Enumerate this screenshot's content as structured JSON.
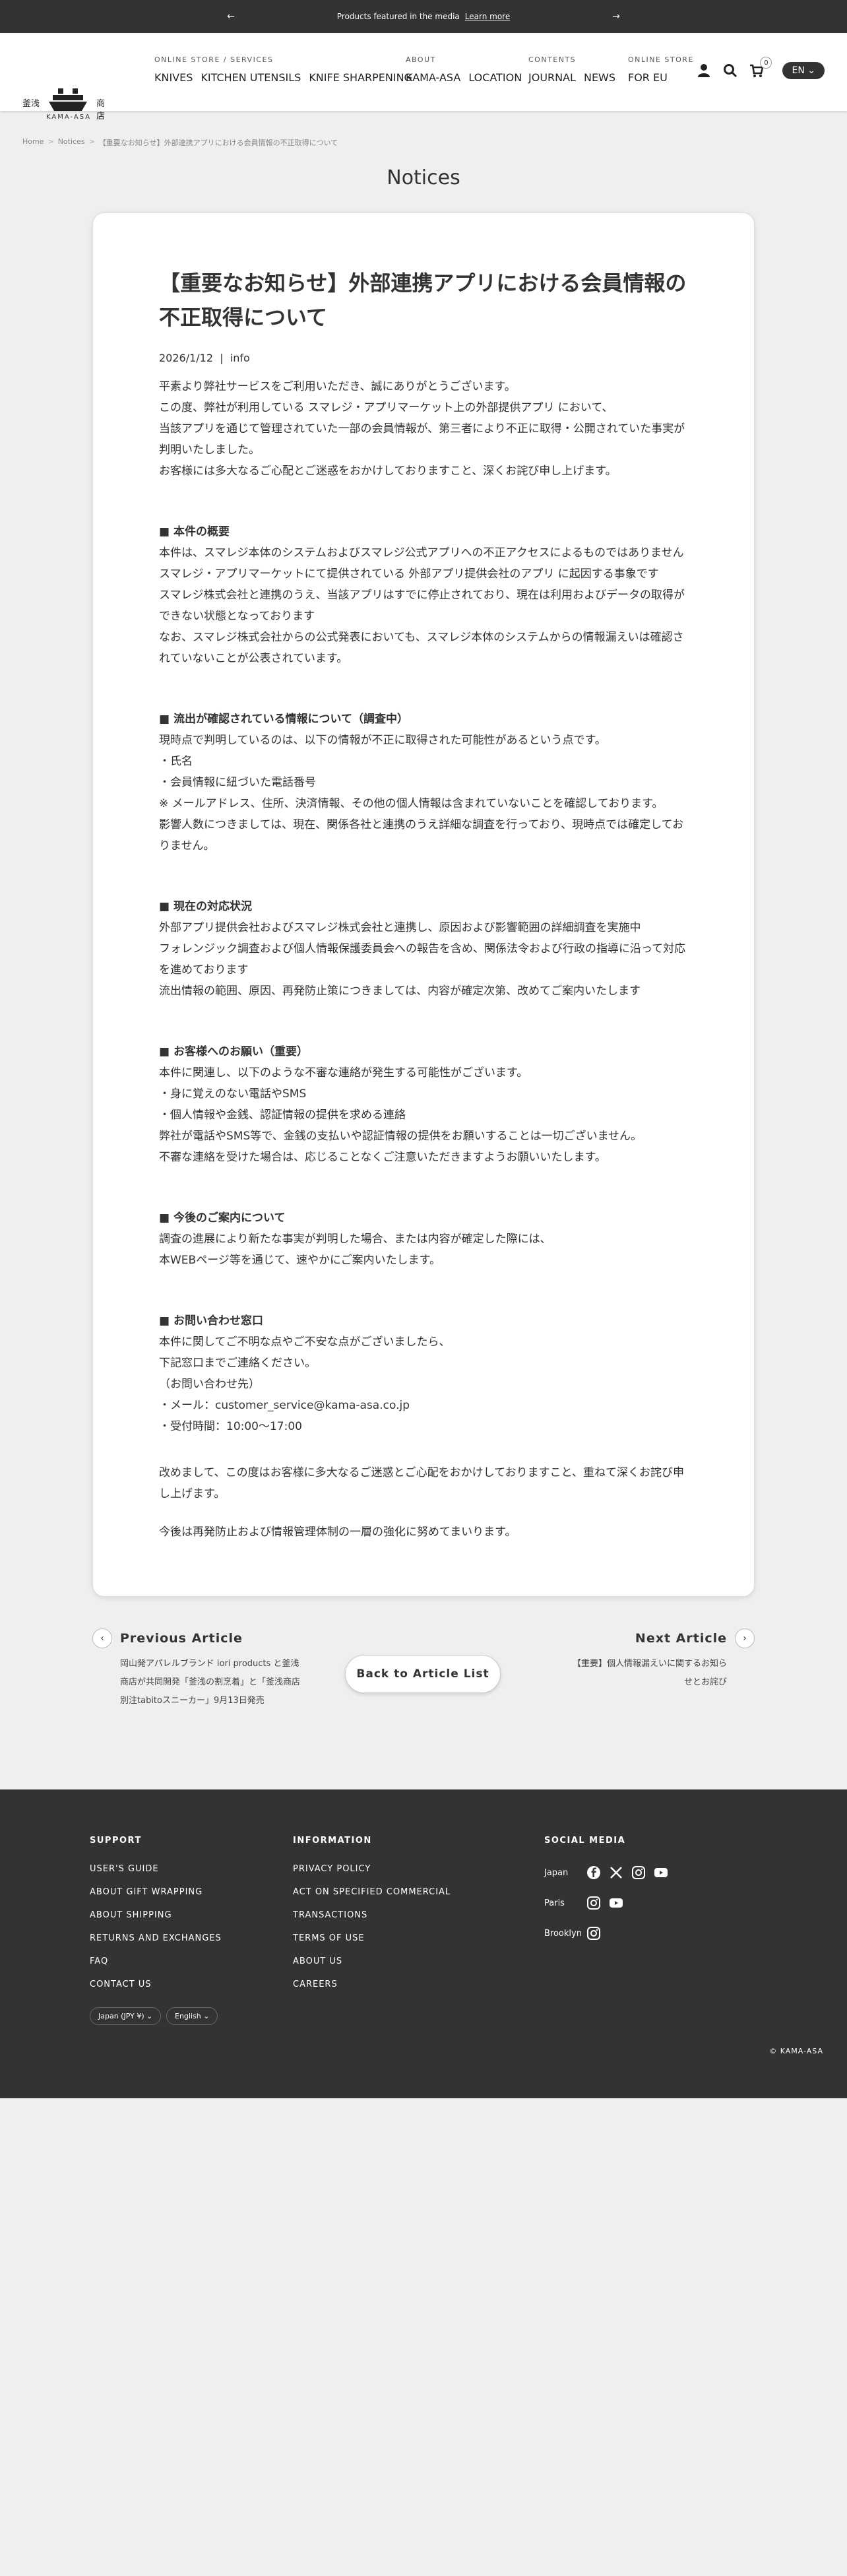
{
  "announcement": {
    "text": "Products featured in the media",
    "link": "Learn more"
  },
  "logo": {
    "kanji_left": "釜浅",
    "kanji_right": "商店",
    "english": "KAMA-ASA"
  },
  "nav": {
    "groups": [
      {
        "category": "ONLINE STORE / SERVICES",
        "links": [
          "KNIVES",
          "KITCHEN UTENSILS",
          "KNIFE SHARPENING"
        ]
      },
      {
        "category": "ABOUT",
        "links": [
          "KAMA-ASA",
          "LOCATION"
        ]
      },
      {
        "category": "CONTENTS",
        "links": [
          "JOURNAL",
          "NEWS"
        ]
      },
      {
        "category": "ONLINE STORE",
        "links": [
          "FOR EU"
        ]
      }
    ],
    "cart_count": "0",
    "language": "EN"
  },
  "breadcrumb": {
    "home": "Home",
    "notices": "Notices",
    "current": "【重要なお知らせ】外部連携アプリにおける会員情報の不正取得について"
  },
  "page_title": "Notices",
  "article": {
    "title": "【重要なお知らせ】外部連携アプリにおける会員情報の不正取得について",
    "date": "2026/1/12",
    "category": "info",
    "intro": [
      "平素より弊社サービスをご利用いただき、誠にありがとうございます。",
      "この度、弊社が利用している スマレジ・アプリマーケット上の外部提供アプリ において、",
      "当該アプリを通じて管理されていた一部の会員情報が、第三者により不正に取得・公開されていた事実が判明いたしました。",
      "お客様には多大なるご心配とご迷惑をおかけしておりますこと、深くお詫び申し上げます。"
    ],
    "sections": [
      {
        "heading": "■ 本件の概要",
        "lines": [
          "本件は、スマレジ本体のシステムおよびスマレジ公式アプリへの不正アクセスによるものではありません",
          "スマレジ・アプリマーケットにて提供されている 外部アプリ提供会社のアプリ に起因する事象です",
          "スマレジ株式会社と連携のうえ、当該アプリはすでに停止されており、現在は利用およびデータの取得ができない状態となっております",
          "なお、スマレジ株式会社からの公式発表においても、スマレジ本体のシステムからの情報漏えいは確認されていないことが公表されています。"
        ]
      },
      {
        "heading": "■ 流出が確認されている情報について（調査中）",
        "lines": [
          "現時点で判明しているのは、以下の情報が不正に取得された可能性があるという点です。",
          "・氏名",
          "・会員情報に紐づいた電話番号",
          "※ メールアドレス、住所、決済情報、その他の個人情報は含まれていないことを確認しております。",
          "影響人数につきましては、現在、関係各社と連携のうえ詳細な調査を行っており、現時点では確定しておりません。"
        ]
      },
      {
        "heading": "■ 現在の対応状況",
        "lines": [
          "外部アプリ提供会社およびスマレジ株式会社と連携し、原因および影響範囲の詳細調査を実施中",
          "フォレンジック調査および個人情報保護委員会への報告を含め、関係法令および行政の指導に沿って対応を進めております",
          "流出情報の範囲、原因、再発防止策につきましては、内容が確定次第、改めてご案内いたします"
        ]
      },
      {
        "heading": "■ お客様へのお願い（重要）",
        "lines": [
          "本件に関連し、以下のような不審な連絡が発生する可能性がございます。",
          "・身に覚えのない電話やSMS",
          "・個人情報や金銭、認証情報の提供を求める連絡",
          "弊社が電話やSMS等で、金銭の支払いや認証情報の提供をお願いすることは一切ございません。",
          "不審な連絡を受けた場合は、応じることなくご注意いただきますようお願いいたします。"
        ]
      },
      {
        "heading": "■ 今後のご案内について",
        "lines": [
          "調査の進展により新たな事実が判明した場合、または内容が確定した際には、",
          "本WEBページ等を通じて、速やかにご案内いたします。"
        ]
      },
      {
        "heading": "■ お問い合わせ窓口",
        "lines": [
          "本件に関してご不明な点やご不安な点がございましたら、",
          "下記窓口までご連絡ください。",
          "（お問い合わせ先）",
          "・メール：customer_service@kama-asa.co.jp",
          "・受付時間：10:00〜17:00"
        ]
      }
    ],
    "closing": "改めまして、この度はお客様に多大なるご迷惑とご心配をおかけしておりますこと、重ねて深くお詫び申し上げます。",
    "closing2": "今後は再発防止および情報管理体制の一層の強化に努めてまいります。"
  },
  "post_nav": {
    "prev_label": "Previous Article",
    "prev_desc": "岡山発アパレルブランド iori products と釜浅商店が共同開発「釜浅の割烹着」と「釜浅商店別注tabitoスニーカー」9月13日発売",
    "back_label": "Back to Article List",
    "next_label": "Next Article",
    "next_desc": "【重要】個人情報漏えいに関するお知らせとお詫び"
  },
  "footer": {
    "support": {
      "heading": "SUPPORT",
      "links": [
        "USER'S GUIDE",
        "ABOUT GIFT WRAPPING",
        "ABOUT SHIPPING",
        "RETURNS AND EXCHANGES",
        "FAQ",
        "CONTACT US"
      ]
    },
    "information": {
      "heading": "INFORMATION",
      "links": [
        "PRIVACY POLICY",
        "ACT ON SPECIFIED COMMERCIAL TRANSACTIONS",
        "TERMS OF USE",
        "ABOUT US",
        "CAREERS"
      ]
    },
    "social": {
      "heading": "SOCIAL MEDIA",
      "locations": [
        "Japan",
        "Paris",
        "Brooklyn"
      ]
    },
    "currency": "Japan (JPY ¥)",
    "language": "English",
    "copyright": "© KAMA-ASA"
  },
  "colors": {
    "dark": "#333333",
    "page_bg": "#efefef",
    "card_bg": "#ffffff"
  }
}
